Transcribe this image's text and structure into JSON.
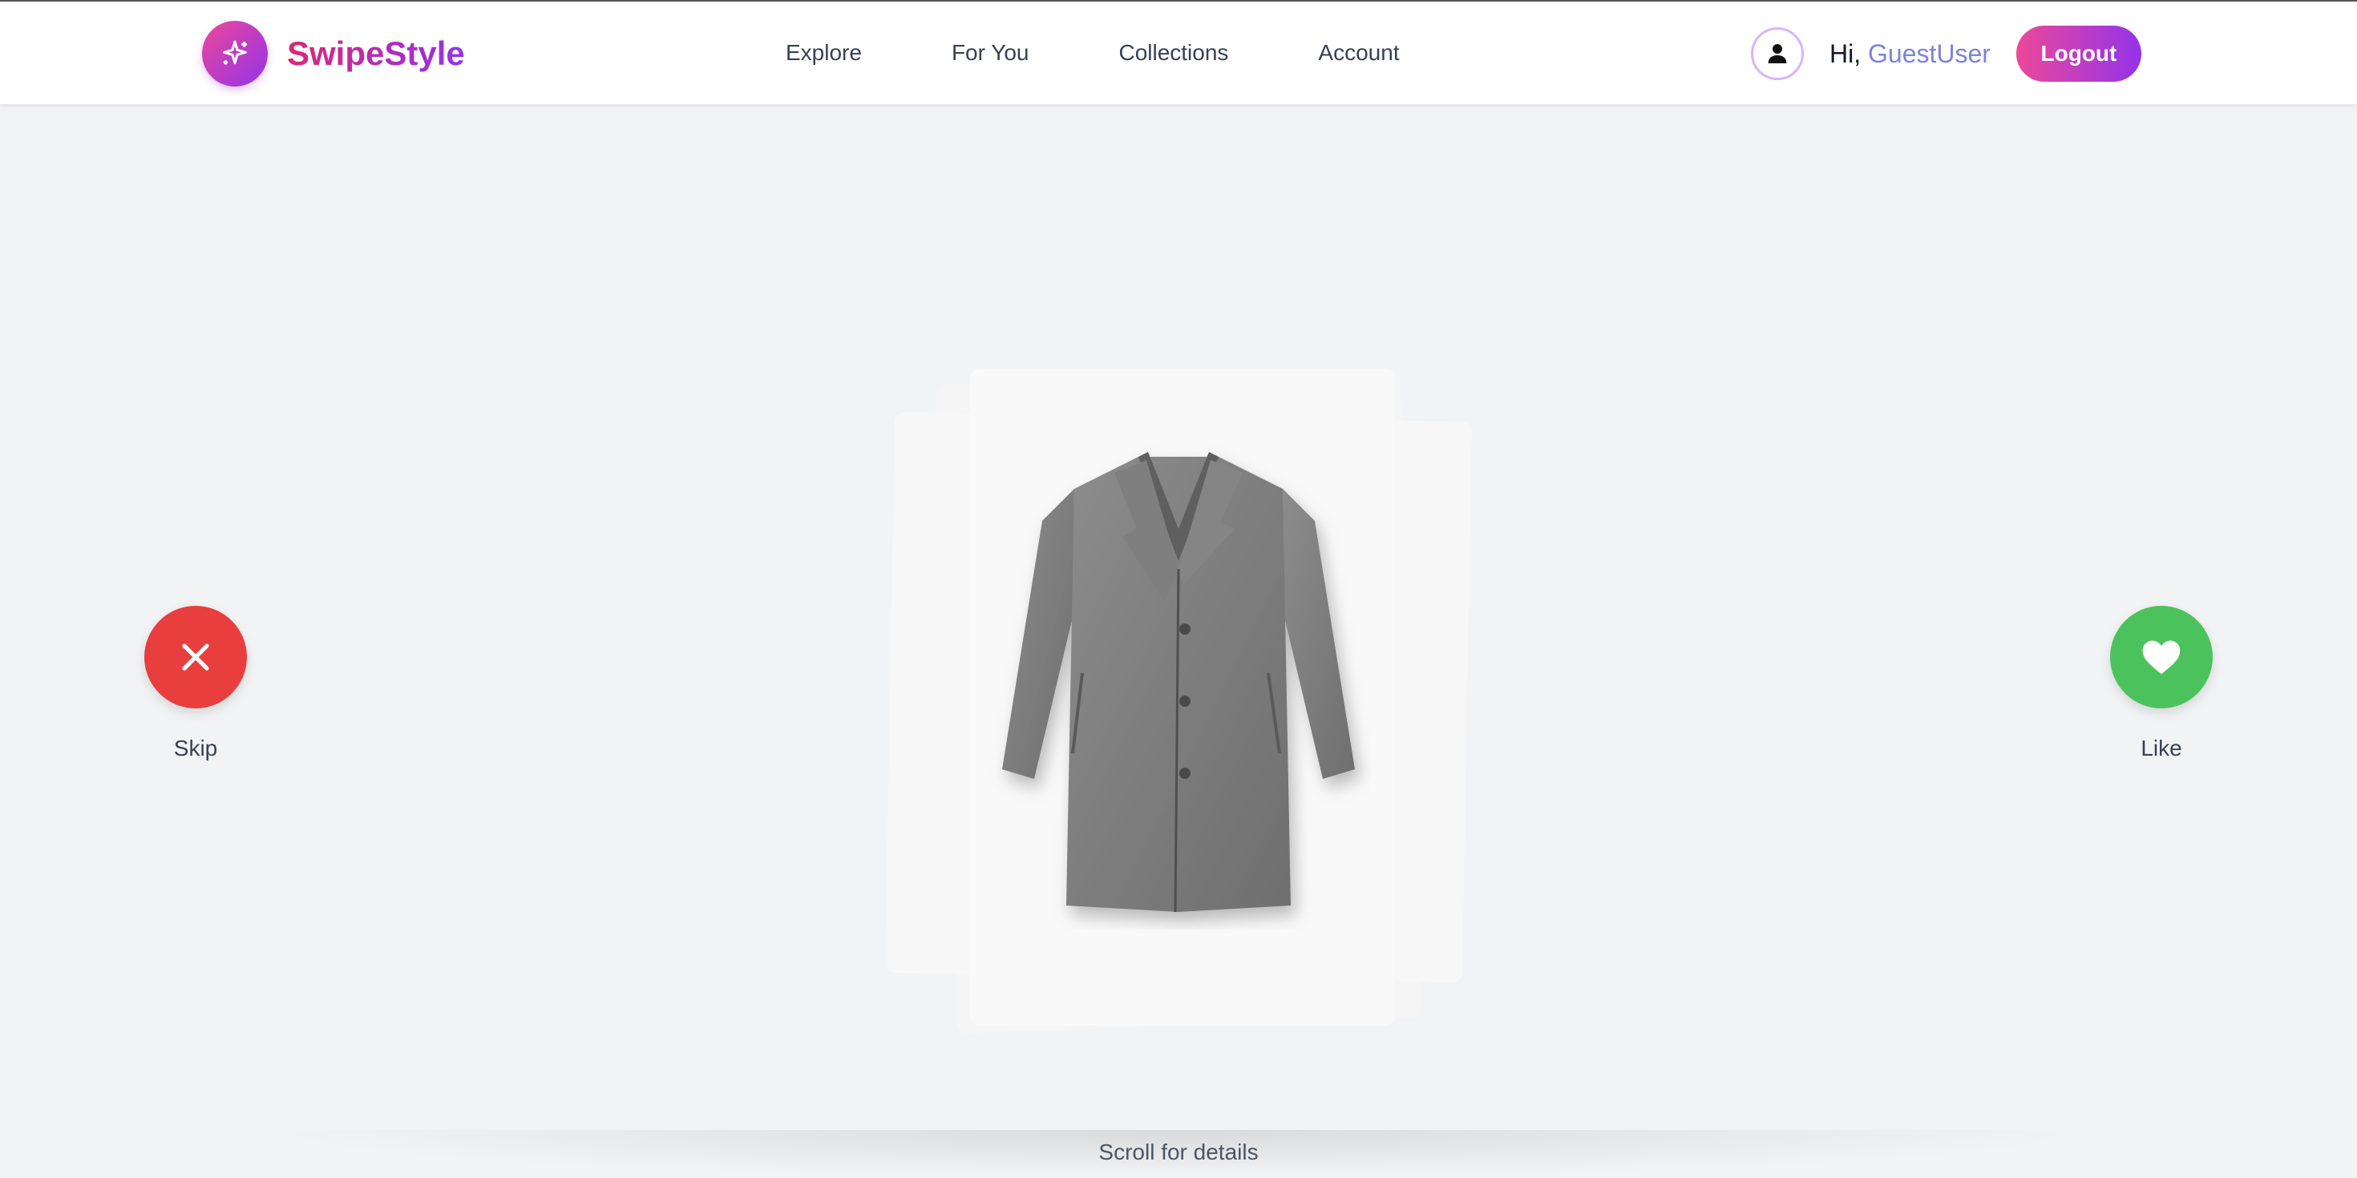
{
  "header": {
    "logo_text": "SwipeStyle",
    "logo_icon": "sparkles-icon",
    "nav": [
      {
        "label": "Explore"
      },
      {
        "label": "For You"
      },
      {
        "label": "Collections"
      },
      {
        "label": "Account"
      }
    ],
    "greeting_prefix": "Hi,",
    "username": "GuestUser",
    "logout_label": "Logout"
  },
  "actions": {
    "skip_label": "Skip",
    "like_label": "Like",
    "skip_icon": "close-icon",
    "like_icon": "heart-icon"
  },
  "product": {
    "image": "grey-wool-coat"
  },
  "footer": {
    "scroll_hint": "Scroll for details"
  },
  "colors": {
    "brand_pink": "#ec4899",
    "brand_purple": "#9333ea",
    "skip_red": "#e83e3e",
    "like_green": "#4cc25c",
    "username_blue": "#7c83d8"
  }
}
